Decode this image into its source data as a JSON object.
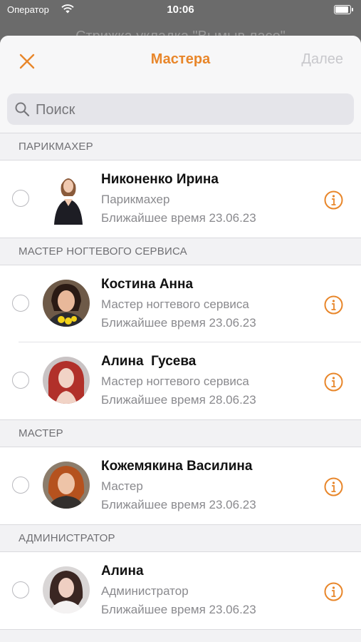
{
  "status_bar": {
    "carrier": "Оператор",
    "time": "10:06"
  },
  "background_title": "Стрижка укладка \"Вымыв ласо\"",
  "nav": {
    "title": "Мастера",
    "next_label": "Далее"
  },
  "search": {
    "placeholder": "Поиск"
  },
  "sections": [
    {
      "header": "ПАРИКМАХЕР",
      "masters": [
        {
          "name": "Никоненко Ирина",
          "role": "Парикмахер",
          "nearest": "Ближайшее время 23.06.23"
        }
      ]
    },
    {
      "header": "МАСТЕР НОГТЕВОГО СЕРВИСА",
      "masters": [
        {
          "name": "Костина Анна",
          "role": "Мастер ногтевого сервиса",
          "nearest": "Ближайшее время 23.06.23"
        },
        {
          "name": "Алина  Гусева",
          "role": "Мастер ногтевого сервиса",
          "nearest": "Ближайшее время 28.06.23"
        }
      ]
    },
    {
      "header": "МАСТЕР",
      "masters": [
        {
          "name": "Кожемякина Василина",
          "role": "Мастер",
          "nearest": "Ближайшее время 23.06.23"
        }
      ]
    },
    {
      "header": "АДМИНИСТРАТОР",
      "masters": [
        {
          "name": "Алина",
          "role": "Администратор",
          "nearest": "Ближайшее время 23.06.23"
        }
      ]
    }
  ],
  "colors": {
    "accent": "#E8862A",
    "disabled": "#C8C8CC",
    "secondary_text": "#8A8A8E"
  }
}
